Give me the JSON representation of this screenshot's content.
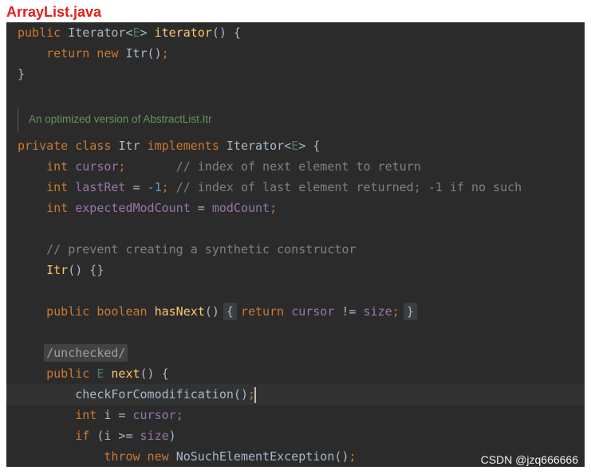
{
  "file": {
    "title": "ArrayList.java"
  },
  "theme": {
    "title": "#e0201c",
    "editor_bg": "#2b2b2b",
    "current_line_bg": "#323232",
    "fold_bg": "#3b3d3f",
    "doc_bar": "#5b5b5b",
    "doc_text": "#629755",
    "caret": "#bbbbbb",
    "watermark": "#f2f2f2"
  },
  "code": {
    "lines": [
      {
        "tokens": [
          {
            "t": "public ",
            "c": "#cc7832"
          },
          {
            "t": "Iterator<",
            "c": "#a9b7c6"
          },
          {
            "t": "E",
            "c": "#507874"
          },
          {
            "t": "> ",
            "c": "#a9b7c6"
          },
          {
            "t": "iterator",
            "c": "#ffc66d"
          },
          {
            "t": "() {",
            "c": "#a9b7c6"
          }
        ]
      },
      {
        "tokens": [
          {
            "t": "    return new ",
            "c": "#cc7832"
          },
          {
            "t": "Itr()",
            "c": "#a9b7c6"
          },
          {
            "t": ";",
            "c": "#cc7832"
          }
        ]
      },
      {
        "tokens": [
          {
            "t": "}",
            "c": "#a9b7c6"
          }
        ]
      },
      {
        "tokens": []
      },
      {
        "doc": "An optimized version of AbstractList.Itr"
      },
      {
        "tokens": [
          {
            "t": "private class ",
            "c": "#cc7832"
          },
          {
            "t": "Itr ",
            "c": "#a9b7c6"
          },
          {
            "t": "implements ",
            "c": "#cc7832"
          },
          {
            "t": "Iterator<",
            "c": "#a9b7c6"
          },
          {
            "t": "E",
            "c": "#507874"
          },
          {
            "t": "> {",
            "c": "#a9b7c6"
          }
        ]
      },
      {
        "tokens": [
          {
            "t": "    int ",
            "c": "#cc7832"
          },
          {
            "t": "cursor",
            "c": "#9876aa"
          },
          {
            "t": ";",
            "c": "#cc7832"
          },
          {
            "t": "       // index of next element to return",
            "c": "#808080"
          }
        ]
      },
      {
        "tokens": [
          {
            "t": "    int ",
            "c": "#cc7832"
          },
          {
            "t": "lastRet",
            "c": "#9876aa"
          },
          {
            "t": " = ",
            "c": "#a9b7c6"
          },
          {
            "t": "-1",
            "c": "#6897bb"
          },
          {
            "t": ";",
            "c": "#cc7832"
          },
          {
            "t": " // index of last element returned; -1 if no such",
            "c": "#808080"
          }
        ]
      },
      {
        "tokens": [
          {
            "t": "    int ",
            "c": "#cc7832"
          },
          {
            "t": "expectedModCount",
            "c": "#9876aa"
          },
          {
            "t": " = ",
            "c": "#a9b7c6"
          },
          {
            "t": "modCount",
            "c": "#9876aa"
          },
          {
            "t": ";",
            "c": "#cc7832"
          }
        ]
      },
      {
        "tokens": []
      },
      {
        "tokens": [
          {
            "t": "    // prevent creating a synthetic constructor",
            "c": "#808080"
          }
        ]
      },
      {
        "tokens": [
          {
            "t": "    Itr",
            "c": "#ffc66d"
          },
          {
            "t": "() {}",
            "c": "#a9b7c6"
          }
        ]
      },
      {
        "tokens": []
      },
      {
        "tokens": [
          {
            "t": "    public boolean ",
            "c": "#cc7832"
          },
          {
            "t": "hasNext",
            "c": "#ffc66d"
          },
          {
            "t": "() ",
            "c": "#a9b7c6"
          },
          {
            "t": "{",
            "c": "#a9b7c6",
            "fold": true
          },
          {
            "t": " return ",
            "c": "#cc7832"
          },
          {
            "t": "cursor",
            "c": "#9876aa"
          },
          {
            "t": " != ",
            "c": "#a9b7c6"
          },
          {
            "t": "size",
            "c": "#9876aa"
          },
          {
            "t": "; ",
            "c": "#cc7832"
          },
          {
            "t": "}",
            "c": "#a9b7c6",
            "fold": true
          }
        ]
      },
      {
        "tokens": []
      },
      {
        "tokens": [
          {
            "t": "    ",
            "c": "#a9b7c6"
          },
          {
            "t": "/unchecked/",
            "c": "#9e9e9e",
            "fold": true,
            "wide": true
          }
        ]
      },
      {
        "tokens": [
          {
            "t": "    public ",
            "c": "#cc7832"
          },
          {
            "t": "E ",
            "c": "#507874"
          },
          {
            "t": "next",
            "c": "#ffc66d"
          },
          {
            "t": "() {",
            "c": "#a9b7c6"
          }
        ]
      },
      {
        "current": true,
        "caret": true,
        "tokens": [
          {
            "t": "        checkForComodification()",
            "c": "#a9b7c6"
          },
          {
            "t": ";",
            "c": "#cc7832"
          }
        ]
      },
      {
        "tokens": [
          {
            "t": "        int ",
            "c": "#cc7832"
          },
          {
            "t": "i = ",
            "c": "#a9b7c6"
          },
          {
            "t": "cursor",
            "c": "#9876aa"
          },
          {
            "t": ";",
            "c": "#cc7832"
          }
        ]
      },
      {
        "tokens": [
          {
            "t": "        if ",
            "c": "#cc7832"
          },
          {
            "t": "(i >= ",
            "c": "#a9b7c6"
          },
          {
            "t": "size",
            "c": "#9876aa"
          },
          {
            "t": ")",
            "c": "#a9b7c6"
          }
        ]
      },
      {
        "tokens": [
          {
            "t": "            throw new ",
            "c": "#cc7832"
          },
          {
            "t": "NoSuchElementException()",
            "c": "#a9b7c6"
          },
          {
            "t": ";",
            "c": "#cc7832"
          }
        ]
      }
    ]
  },
  "watermark": "CSDN @jzq666666"
}
